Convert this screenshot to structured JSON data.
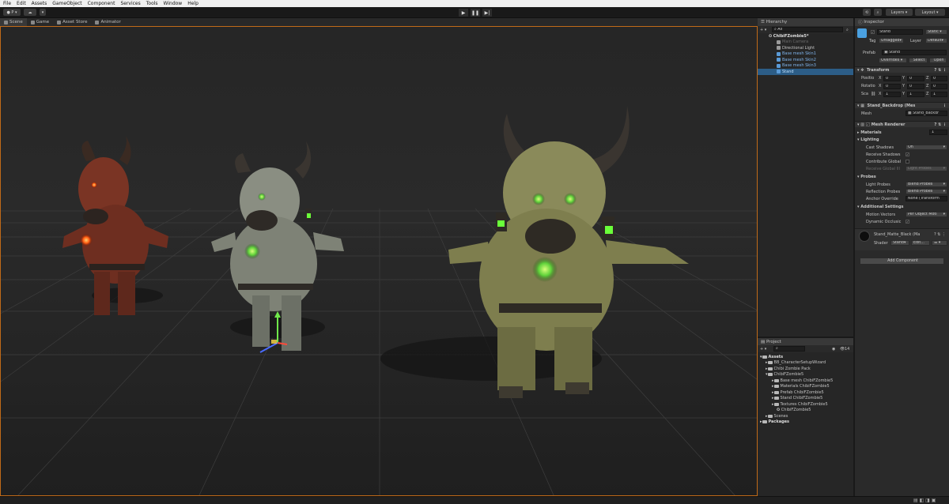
{
  "menu": [
    "File",
    "Edit",
    "Assets",
    "GameObject",
    "Component",
    "Services",
    "Tools",
    "Window",
    "Help"
  ],
  "toolbar": {
    "account_label": "P",
    "layers_label": "Layers",
    "layout_label": "Layout"
  },
  "scene_tabs": [
    "Scene",
    "Game",
    "Asset Store",
    "Animator"
  ],
  "hierarchy": {
    "title": "Hierarchy",
    "search_placeholder": "All",
    "scene": "ChibiFZombie5*",
    "items": [
      "Main Camera",
      "Directional Light",
      "Base mesh Skin1",
      "Base mesh Skin2",
      "Base mesh Skin3",
      "Stand"
    ]
  },
  "project": {
    "title": "Project",
    "badge": "14",
    "assets_label": "Assets",
    "folders": [
      "BB_CharacterSetupWizard",
      "Chibi Zombie Pack",
      "ChibiFZombie5"
    ],
    "subfolders": [
      "Base mesh ChibiFZombie5",
      "Materials ChibiFZombie5",
      "Prefab ChibiFZombie5",
      "Stand ChibiFZombie5",
      "Textures ChibiFZombie5",
      "ChibiFZombie5"
    ],
    "scenes_label": "Scenes",
    "packages_label": "Packages"
  },
  "inspector": {
    "title": "Inspector",
    "name": "Stand",
    "static_label": "Static",
    "tag_label": "Tag",
    "tag_value": "Untagged",
    "layer_label": "Layer",
    "layer_value": "Default",
    "prefab_label": "Prefab",
    "prefab_value": "Stand",
    "overrides_label": "Overrides",
    "select_label": "Select",
    "open_label": "Open",
    "transform": {
      "title": "Transform",
      "position_label": "Positio",
      "rotation_label": "Rotatio",
      "scale_label": "Sca",
      "x": "X",
      "y": "Y",
      "z": "Z",
      "position": [
        "0",
        "0",
        "0"
      ],
      "rotation": [
        "0",
        "0",
        "0"
      ],
      "scale": [
        "1",
        "1",
        "1"
      ]
    },
    "mesh_filter": {
      "title": "Stand_Backdrop (Mes",
      "mesh_label": "Mesh",
      "mesh_value": "Stand_Backdr"
    },
    "mesh_renderer": {
      "title": "Mesh Renderer",
      "materials_label": "Materials",
      "materials_count": "1",
      "lighting_label": "Lighting",
      "cast_shadows_label": "Cast Shadows",
      "cast_shadows_value": "On",
      "receive_shadows_label": "Receive Shadows",
      "contribute_gi_label": "Contribute Global",
      "receive_gi_label": "Receive Global Ill",
      "receive_gi_value": "Light Probes",
      "probes_label": "Probes",
      "light_probes_label": "Light Probes",
      "light_probes_value": "Blend Probes",
      "reflection_probes_label": "Reflection Probes",
      "reflection_probes_value": "Blend Probes",
      "anchor_override_label": "Anchor Override",
      "anchor_override_value": "None (Transform",
      "additional_label": "Additional Settings",
      "motion_vectors_label": "Motion Vectors",
      "motion_vectors_value": "Per Object Moti",
      "dynamic_occlusion_label": "Dynamic Occlusic"
    },
    "material": {
      "name": "Stand_Matte_Black (Ma",
      "shader_label": "Shader",
      "shader_value": "Stand",
      "edit_label": "Edit..."
    },
    "add_component_label": "Add Component"
  },
  "colors": {
    "accent": "#c06a18",
    "selection": "#2c5d87",
    "link_blue": "#7fb4ec"
  }
}
